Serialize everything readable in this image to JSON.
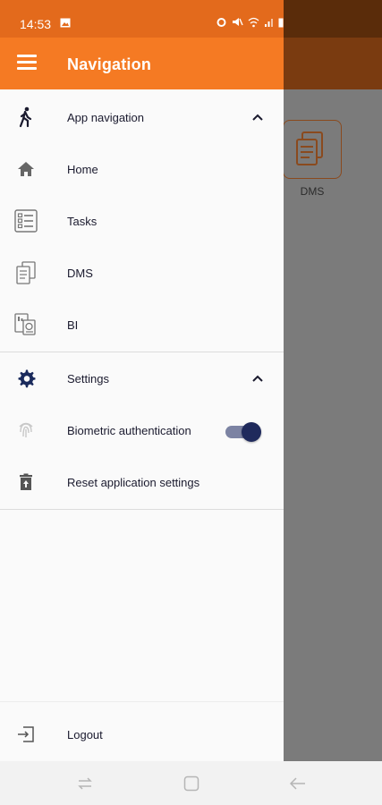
{
  "status_bar": {
    "time": "14:53"
  },
  "drawer": {
    "header": {
      "title": "Navigation"
    },
    "sections": [
      {
        "title": "App navigation",
        "icon": "walking-person-icon",
        "items": [
          {
            "label": "Home",
            "icon": "home-icon"
          },
          {
            "label": "Tasks",
            "icon": "checklist-icon"
          },
          {
            "label": "DMS",
            "icon": "documents-icon"
          },
          {
            "label": "BI",
            "icon": "report-icon"
          }
        ]
      },
      {
        "title": "Settings",
        "icon": "gear-icon",
        "items": [
          {
            "label": "Biometric authentication",
            "icon": "fingerprint-icon",
            "toggle": true
          },
          {
            "label": "Reset application settings",
            "icon": "trash-icon"
          }
        ]
      }
    ],
    "footer": {
      "label": "Logout",
      "icon": "logout-icon"
    }
  },
  "background_app": {
    "tile_label": "DMS"
  },
  "colors": {
    "header": "#f57a23",
    "status": "#e36a1c",
    "accent_dark": "#1f2a5c"
  }
}
